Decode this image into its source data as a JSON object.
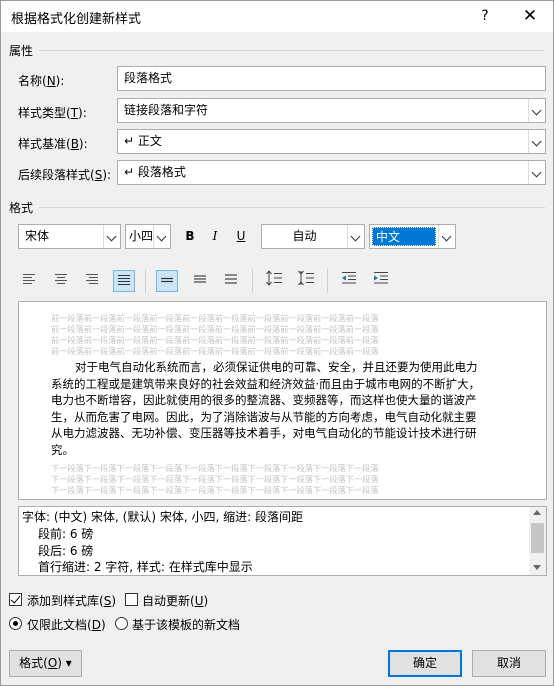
{
  "dialog": {
    "title": "根据格式化创建新样式",
    "help_label": "?",
    "close_label": "✕"
  },
  "properties": {
    "group_label": "属性",
    "name": {
      "label": "名称(",
      "key": "N",
      "suffix": "):",
      "value": "段落格式"
    },
    "type": {
      "label": "样式类型(",
      "key": "T",
      "suffix": "):",
      "value": "链接段落和字符"
    },
    "based_on": {
      "label": "样式基准(",
      "key": "B",
      "suffix": "):",
      "value": "↵ 正文"
    },
    "following": {
      "label": "后续段落样式(",
      "key": "S",
      "suffix": "):",
      "value": "↵ 段落格式"
    }
  },
  "format": {
    "group_label": "格式",
    "font_name": "宋体",
    "font_size": "小四",
    "bold": "B",
    "italic": "I",
    "underline": "U",
    "color": "自动",
    "script": "中文"
  },
  "preview": {
    "prev_para": "前一段落前一段落前一段落前一段落前一段落前一段落前一段落前一段落前一段落前一段落",
    "next_para": "下一段落下一段落下一段落下一段落下一段落下一段落下一段落下一段落下一段落下一段落",
    "sample_lines": [
      "对于电气自动化系统而言，必须保证供电的可靠、安全，并且还要为使用此电力",
      "系统的工程或是建筑带来良好的社会效益和经济效益·而且由于城市电网的不断扩大，",
      "电力也不断增容，因此就使用的很多的整流器、变频器等，而这样也使大量的谐波产",
      "生，从而危害了电网。因此，为了消除谐波与从节能的方向考虑，电气自动化就主要",
      "从电力滤波器、无功补偿、变压器等技术着手，对电气自动化的节能设计技术进行研",
      "究。"
    ]
  },
  "description": {
    "lines": [
      "字体: (中文) 宋体, (默认) 宋体, 小四, 缩进: 段落间距",
      "段前: 6 磅",
      "段后: 6 磅",
      "首行缩进:  2 字符, 样式: 在样式库中显示"
    ]
  },
  "options": {
    "add_to_gallery": {
      "label": "添加到样式库(",
      "key": "S",
      "suffix": ")",
      "checked": true
    },
    "auto_update": {
      "label": "自动更新(",
      "key": "U",
      "suffix": ")",
      "checked": false
    },
    "only_this_doc": {
      "label": "仅限此文档(",
      "key": "D",
      "suffix": ")",
      "checked": true
    },
    "new_docs": {
      "label": "基于该模板的新文档",
      "checked": false
    }
  },
  "buttons": {
    "format": {
      "label": "格式(",
      "key": "O",
      "suffix": ") ▾"
    },
    "ok": "确定",
    "cancel": "取消"
  }
}
